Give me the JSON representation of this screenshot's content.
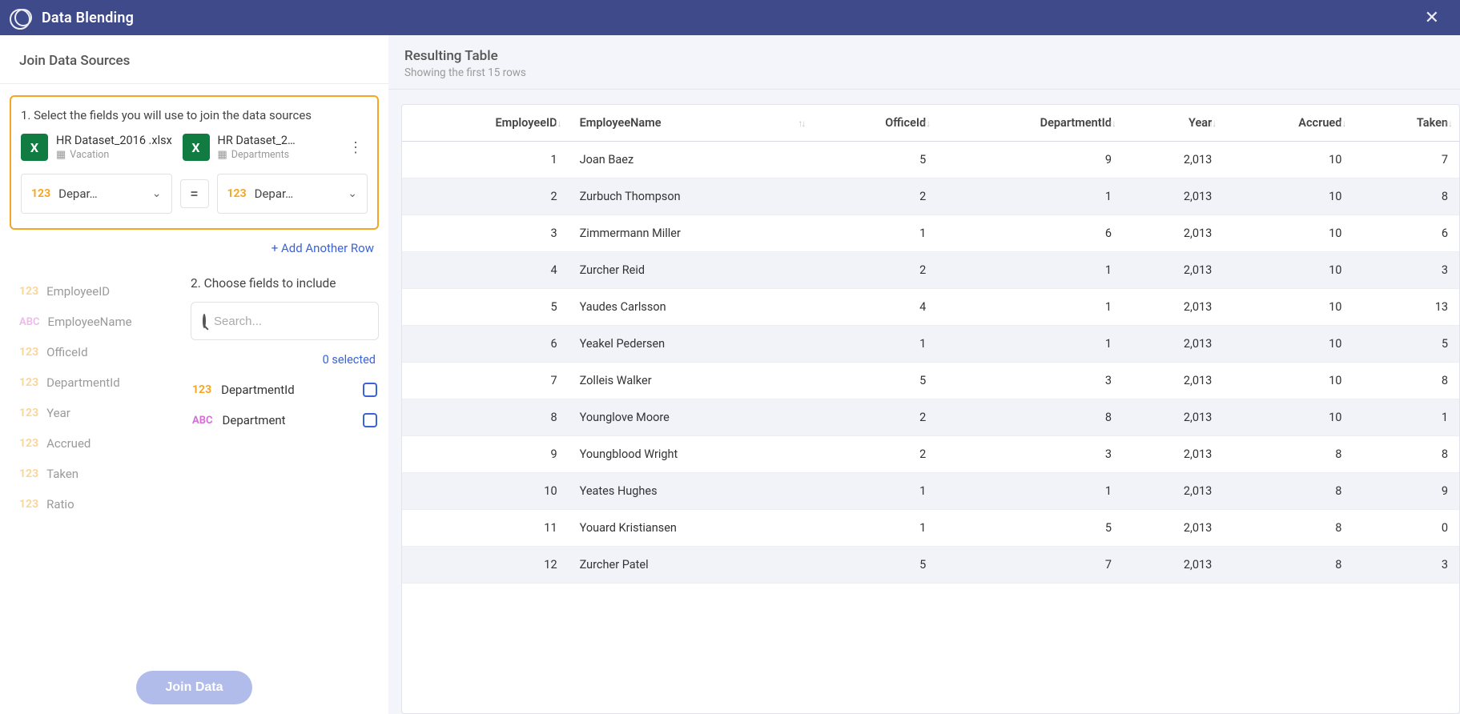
{
  "titlebar": {
    "title": "Data Blending"
  },
  "left": {
    "header": "Join Data Sources",
    "step1": "1. Select the fields you will use to join the data sources",
    "source1": {
      "name": "HR Dataset_2016 .xlsx",
      "sheet": "Vacation"
    },
    "source2": {
      "name": "HR Dataset_2…",
      "sheet": "Departments"
    },
    "field1": "Depar…",
    "field2": "Depar…",
    "equals": "=",
    "addRow": "+ Add Another Row",
    "fields": [
      {
        "type": "123",
        "name": "EmployeeID"
      },
      {
        "type": "abc",
        "name": "EmployeeName"
      },
      {
        "type": "123",
        "name": "OfficeId"
      },
      {
        "type": "123",
        "name": "DepartmentId"
      },
      {
        "type": "123",
        "name": "Year"
      },
      {
        "type": "123",
        "name": "Accrued"
      },
      {
        "type": "123",
        "name": "Taken"
      },
      {
        "type": "123",
        "name": "Ratio"
      }
    ],
    "step2": "2. Choose fields to include",
    "searchPlaceholder": "Search...",
    "selectedCount": "0 selected",
    "includeFields": [
      {
        "type": "123",
        "name": "DepartmentId"
      },
      {
        "type": "abc",
        "name": "Department"
      }
    ],
    "joinButton": "Join Data"
  },
  "right": {
    "title": "Resulting Table",
    "subtitle": "Showing the first 15 rows",
    "columns": [
      "EmployeeID",
      "EmployeeName",
      "OfficeId",
      "DepartmentId",
      "Year",
      "Accrued",
      "Taken"
    ],
    "numericCols": [
      true,
      false,
      true,
      true,
      true,
      true,
      true
    ],
    "rows": [
      [
        1,
        "Joan Baez",
        5,
        9,
        "2,013",
        10,
        7
      ],
      [
        2,
        "Zurbuch Thompson",
        2,
        1,
        "2,013",
        10,
        8
      ],
      [
        3,
        "Zimmermann Miller",
        1,
        6,
        "2,013",
        10,
        6
      ],
      [
        4,
        "Zurcher Reid",
        2,
        1,
        "2,013",
        10,
        3
      ],
      [
        5,
        "Yaudes Carlsson",
        4,
        1,
        "2,013",
        10,
        13
      ],
      [
        6,
        "Yeakel Pedersen",
        1,
        1,
        "2,013",
        10,
        5
      ],
      [
        7,
        "Zolleis Walker",
        5,
        3,
        "2,013",
        10,
        8
      ],
      [
        8,
        "Younglove Moore",
        2,
        8,
        "2,013",
        10,
        1
      ],
      [
        9,
        "Youngblood Wright",
        2,
        3,
        "2,013",
        8,
        8
      ],
      [
        10,
        "Yeates Hughes",
        1,
        1,
        "2,013",
        8,
        9
      ],
      [
        11,
        "Youard Kristiansen",
        1,
        5,
        "2,013",
        8,
        0
      ],
      [
        12,
        "Zurcher Patel",
        5,
        7,
        "2,013",
        8,
        3
      ]
    ]
  }
}
